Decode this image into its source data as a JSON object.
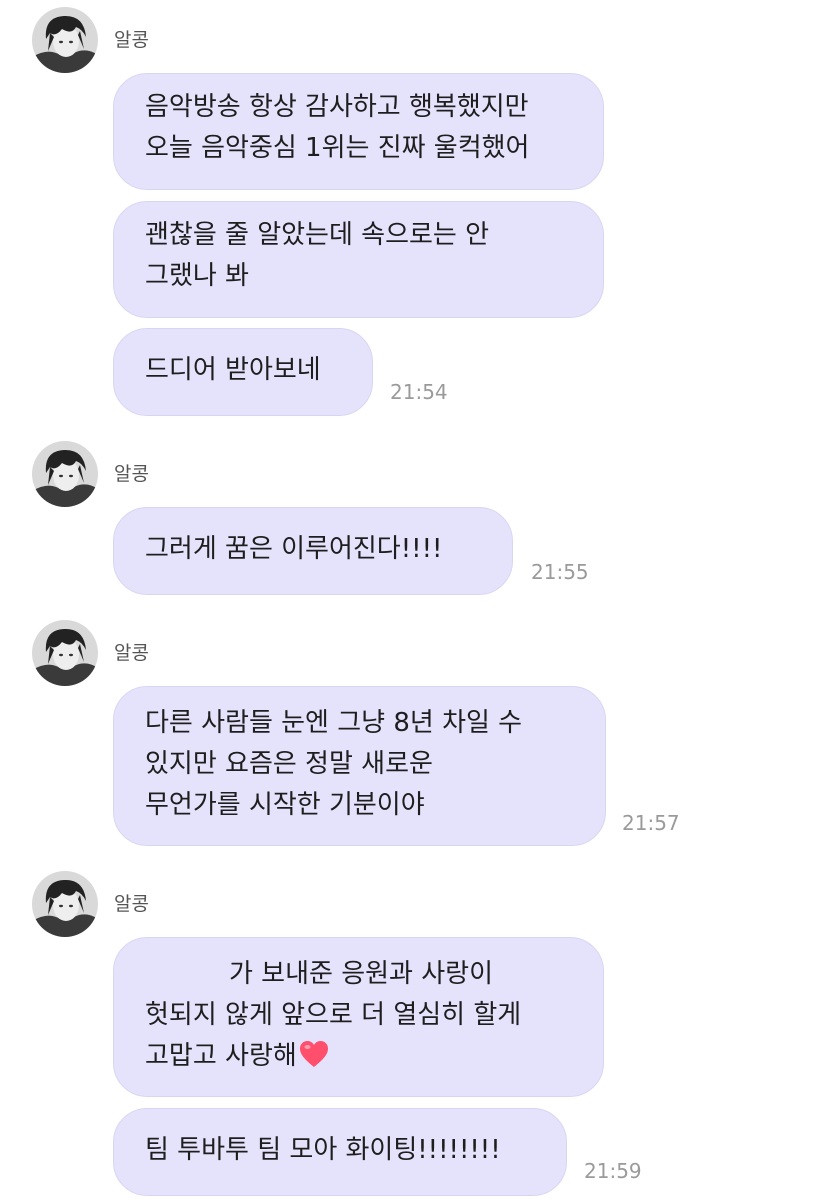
{
  "messages": [
    {
      "sender": "알콩",
      "bubbles": [
        {
          "lines": [
            "음악방송 항상 감사하고 행복했지만",
            "오늘 음악중심 1위는 진짜 울컥했어"
          ]
        },
        {
          "lines": [
            "괜찮을 줄 알았는데 속으로는 안",
            "그랬나 봐"
          ]
        },
        {
          "lines": [
            "드디어 받아보네"
          ]
        }
      ],
      "time": "21:54"
    },
    {
      "sender": "알콩",
      "bubbles": [
        {
          "lines": [
            "그러게 꿈은 이루어진다!!!!"
          ]
        }
      ],
      "time": "21:55"
    },
    {
      "sender": "알콩",
      "bubbles": [
        {
          "lines": [
            "다른 사람들 눈엔 그냥 8년 차일 수",
            "있지만 요즘은 정말 새로운",
            "무언가를 시작한 기분이야"
          ]
        }
      ],
      "time": "21:57"
    },
    {
      "sender": "알콩",
      "bubbles": [
        {
          "lines": [
            "가 보내준 응원과 사랑이",
            "헛되지 않게 앞으로 더 열심히 할게",
            "고맙고 사랑해"
          ]
        },
        {
          "lines": [
            "팀 투바투 팀 모아 화이팅!!!!!!!!"
          ]
        }
      ],
      "time": "21:59"
    }
  ],
  "icons": {
    "avatar": "profile-photo",
    "heart": "red-heart-emoji"
  },
  "colors": {
    "bubble": "#e5e3fb",
    "time": "#9a9a9a",
    "sender": "#555555",
    "heart": "#ff4f6d"
  }
}
